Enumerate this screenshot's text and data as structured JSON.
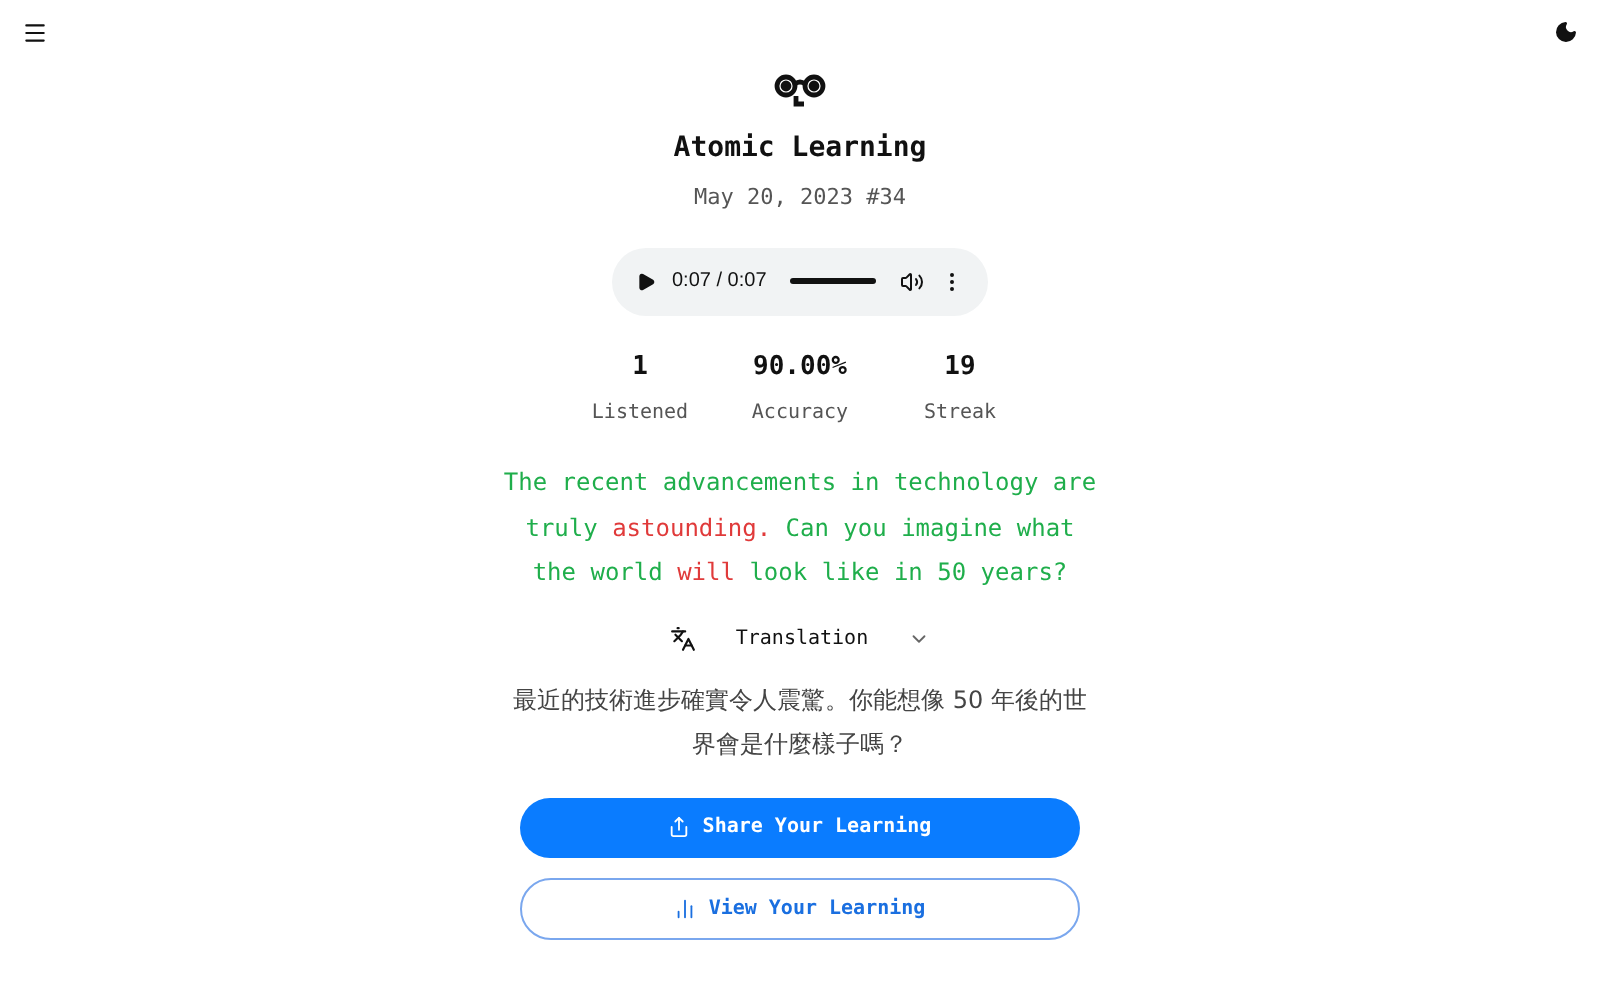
{
  "title": "Atomic Learning",
  "subtitle": "May 20, 2023 #34",
  "audio": {
    "time": "0:07 / 0:07",
    "level": 1
  },
  "stats": [
    {
      "value": "1",
      "label": "Listened"
    },
    {
      "value": "90.00%",
      "label": "Accuracy"
    },
    {
      "value": "19",
      "label": "Streak"
    }
  ],
  "sentence": [
    {
      "text": "The recent advancements in technology are truly ",
      "correct": true
    },
    {
      "text": "astounding.",
      "correct": false
    },
    {
      "text": " Can you imagine what the world ",
      "correct": true
    },
    {
      "text": "will",
      "correct": false
    },
    {
      "text": " look like in 50 years?",
      "correct": true
    }
  ],
  "translation": {
    "label": "Translation",
    "expanded": true,
    "text": "最近的技術進步確實令人震驚。你能想像 50 年後的世界會是什麼樣子嗎？"
  },
  "buttons": [
    {
      "kind": "primary",
      "label": "Share Your Learning"
    },
    {
      "kind": "outline",
      "label": "View Your Learning"
    }
  ]
}
